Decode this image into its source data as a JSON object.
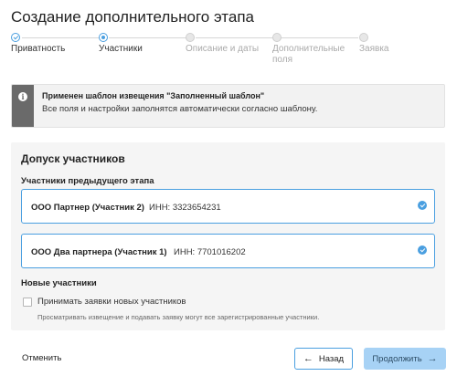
{
  "page": {
    "title": "Создание дополнительного этапа"
  },
  "stepper": {
    "steps": [
      {
        "label": "Приватность",
        "state": "done"
      },
      {
        "label": "Участники",
        "state": "active"
      },
      {
        "label": "Описание и даты",
        "state": "todo"
      },
      {
        "label": "Дополнительные",
        "label2": "поля",
        "state": "todo"
      },
      {
        "label": "Заявка",
        "state": "todo"
      }
    ]
  },
  "notice": {
    "icon": "info-icon",
    "title": "Применен шаблон извещения \"Заполненный шаблон\"",
    "text": "Все поля и настройки заполнятся автоматически согласно шаблону."
  },
  "admission": {
    "title": "Допуск участников",
    "previous_label": "Участники предыдущего этапа",
    "participants": [
      {
        "name": "ООО Партнер (Участник 2)",
        "inn": "ИНН: 3323654231",
        "selected": true
      },
      {
        "name": "ООО Два партнера (Участник 1)",
        "inn": "ИНН: 7701016202",
        "selected": true
      }
    ],
    "new_label": "Новые участники",
    "accept_new": {
      "label": "Принимать заявки новых участников",
      "checked": false
    },
    "hint": "Просматривать извещение и подавать заявку могут все зарегистрированные участники."
  },
  "footer": {
    "cancel": "Отменить",
    "back": "Назад",
    "next": "Продолжить"
  },
  "colors": {
    "accent": "#4a9fe0",
    "primary_disabled": "#a7d2f5",
    "notice_bar": "#6a6a6a"
  }
}
